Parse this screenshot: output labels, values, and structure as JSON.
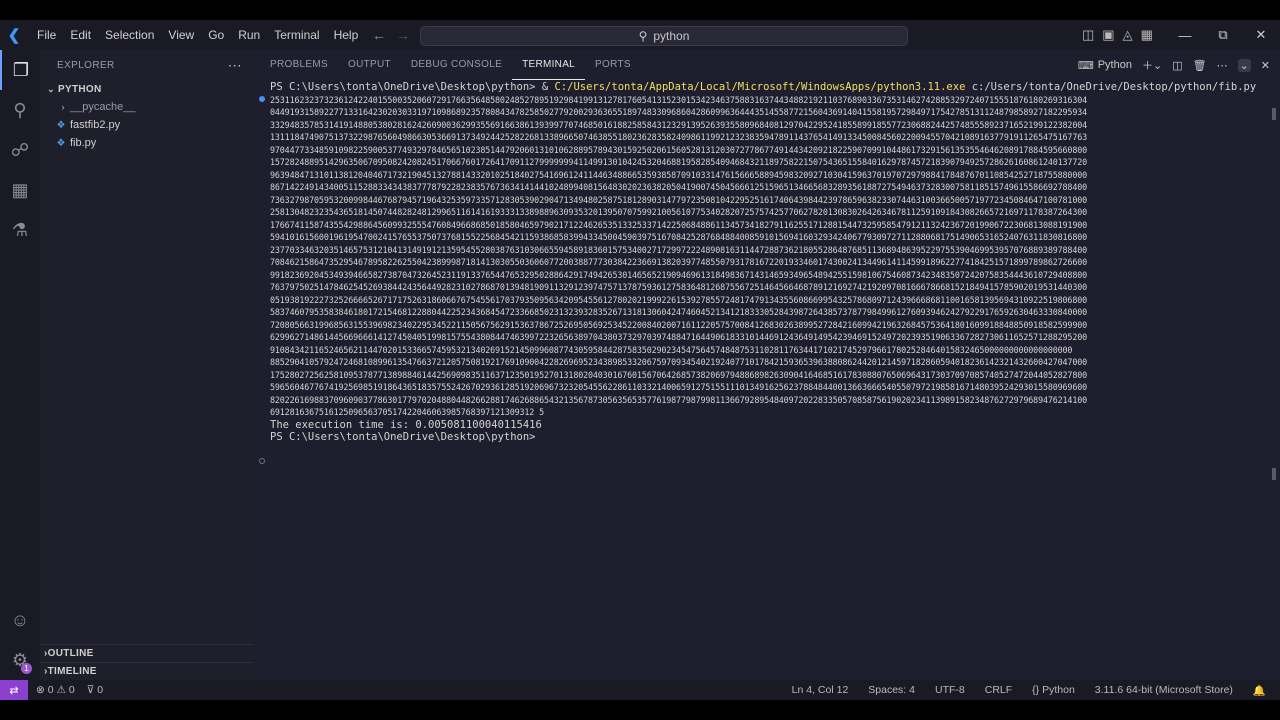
{
  "menu": [
    "File",
    "Edit",
    "Selection",
    "View",
    "Go",
    "Run",
    "Terminal",
    "Help"
  ],
  "search": {
    "text": "python"
  },
  "sidebar": {
    "title": "EXPLORER",
    "root": "PYTHON",
    "items": [
      {
        "label": "__pycache__",
        "type": "folder"
      },
      {
        "label": "fastfib2.py",
        "type": "file"
      },
      {
        "label": "fib.py",
        "type": "file"
      }
    ],
    "outline": "OUTLINE",
    "timeline": "TIMELINE"
  },
  "panel": {
    "tabs": [
      "PROBLEMS",
      "OUTPUT",
      "DEBUG CONSOLE",
      "TERMINAL",
      "PORTS"
    ],
    "active_tab": "TERMINAL",
    "terminal_name": "Python"
  },
  "terminal": {
    "prompt": "PS C:\\Users\\tonta\\OneDrive\\Desktop\\python> ",
    "command_amp": "& ",
    "executable": "C:/Users/tonta/AppData/Local/Microsoft/WindowsApps/python3.11.exe",
    "script": " c:/Users/tonta/OneDrive/Desktop/python/fib.py",
    "output_lines": [
      "25311623237323612422401550035206072917663564858024852789519298419913127817605413152301534234637588316374434882192110376890336735314627428853297240715551876180269316304",
      "04491931589227713316423020303319710986892357808434782585027792002936365518974833096860428609963644435145587721560436914041558195729849717542785131124879858927182295934",
      "33294835785314191488053802816242609003629935569166386139399770746850161882585843123291395263935580968408129704229524185589918557723068824425748555892371652199122382004",
      "13111847490751373229876560498663053669137349244252822681338966507463855180236283582409861199212323835947891143765414913345008456022009455704210891637791911265475167763",
      "97044773348591098225900537749329784656510238514479206013101062889578943015925020615605281312030727786774914434209218225907099104486173291561353554646208917884595660800",
      "15728248895142963506709508242082451706676017264170911279999999411499130104245320468819582854094684321189758221507543651558401629787457218390794925728626160861240137720",
      "96394847131011381204046717321904513278814332010251840275416961241144634886653593858709103314761566658894598320927103041596370197072979884178487670110854252718755880000",
      "86714224914340051152883343438377787922823835767363414144102489940815648302023638205041900745045666125159651346656832893561887275494637328300758118515749615586692788400",
      "73632798705953200998446768794571964325359733571283053902904713494802587518128903147797235081042295251617406439844239786596382330744631003665005719772345084647100781000",
      "25813048232354365181450744828248129965116141619333133898896309353201395070759921005610775340282072575742577062782013083026426346781125910918430826657216971178387264300",
      "17667411587435542988645609932555476084966868501858046597902171224626535133253371422506848861134573418279116255171288154473259585479121132423672019906722306813088191900",
      "59410161560019619547002415765537507376815522568454211593868583994334500459039751670842528768488400859101569416032934240677930972711288068175149065316524076311830816800",
      "23770334632035146575312104131491912135954552803876310306655945891836015753400271729972224890816311447288736218055286487685113689486395229755390469953957076889389788400",
      "70846215864735295467895822625504238999871814130305503606077200388777303842236691382039774855079317816722019334601743002413449614114599189622774184251571899789862726600",
      "99182369204534939466582738704732645231191337654476532950288642917494265301465652190946961318498367143146593496548942551598106754608734234835072420758354443610729408800",
      "76379750251478462545269384424356449282310278687013948190911329123974757137875936127583648126875567251464566468789121692742192097081666786681521849415785902019531440300",
      "05193819222732526666526717175263186066767545561703793509563420954556127802021999226153927855724817479134355608669954325786809712439666868110016581395694310922519806800",
      "58374607953583846180172154681228804422523436845472336685023132393283526713181306042474604521341218333052843987264385737877984996127609394624279229176592630463330840000",
      "72080566319968563155396982340229534522115056756291536378672526950569253452200840200716112205757008412683026389952728421609942196326845753641801609918848850918582599900",
      "62996271486144566966614127450405199815755438084474639972232656389704380373297039748847164490618331014469124364914954239469152497202393519063367282730611652571288295200",
      "91084342116524656211447020153366574595321340269152145099608774305958442875835029023454756457484875311028117634417102174529796617802528464015832465000000000000000000",
      "88529041057924724681089961354766372120575081921769109004228269695234389853320675970934540219240771017842159365396388086244201214597182860594018236142321432600427047000",
      "17528027256258109537877138988461442569098351163712350195270131802040301676015670642685738206979488689826309041646851617830880765069643173037097085740527472044052827800",
      "59656046776741925698519186436518357552426702936128519206967323205455622861103321400659127515511101349162562378848440013663666540550797219858167148039524293015580969600",
      "82022616988370960903778630177970204880448266288174626886543213567873056356535776198779879981136679289548409720228335057085875619020234113989158234876272979689476214100",
      "691281636751612509656370517422046063985768397121309312 5"
    ],
    "exec_time_line": "The execution time is: 0.005081100040115416"
  },
  "statusbar": {
    "errors": "0",
    "warnings": "0",
    "ports": "0",
    "position": "Ln 4, Col 12",
    "spaces": "Spaces: 4",
    "encoding": "UTF-8",
    "eol": "CRLF",
    "language": "Python",
    "interpreter": "3.11.6 64-bit (Microsoft Store)"
  }
}
